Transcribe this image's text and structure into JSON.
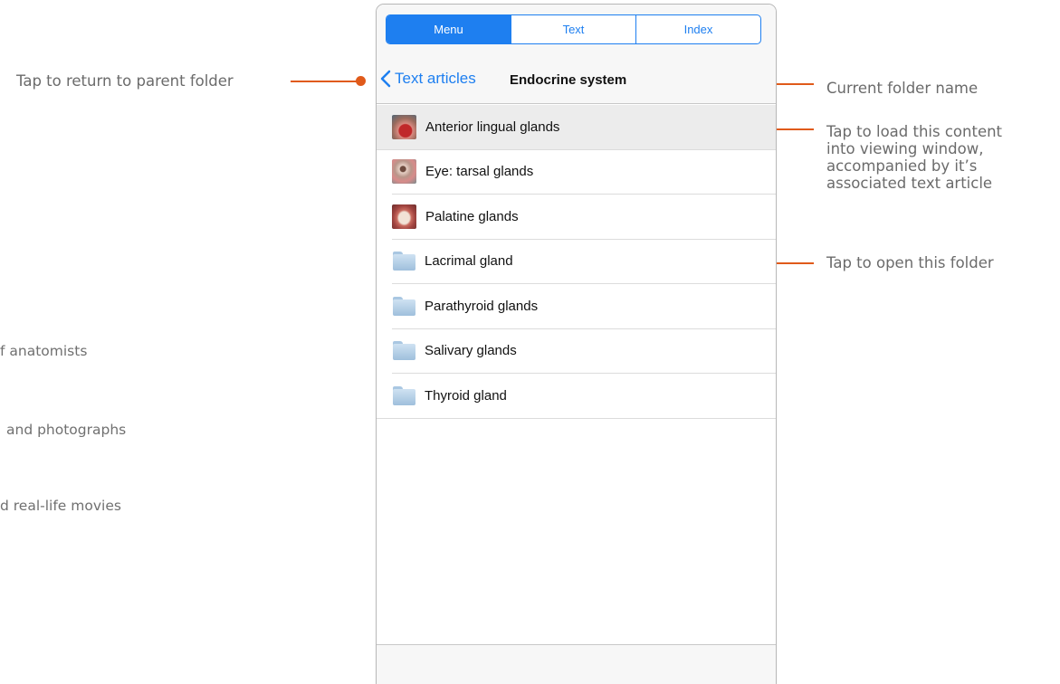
{
  "tabs": [
    {
      "label": "Menu",
      "active": true
    },
    {
      "label": "Text",
      "active": false
    },
    {
      "label": "Index",
      "active": false
    }
  ],
  "nav": {
    "back_label": "Text articles",
    "folder_title": "Endocrine system"
  },
  "items": [
    {
      "label": "Anterior lingual glands",
      "type": "article",
      "selected": true
    },
    {
      "label": "Eye: tarsal glands",
      "type": "article",
      "selected": false
    },
    {
      "label": "Palatine glands",
      "type": "article",
      "selected": false
    },
    {
      "label": "Lacrimal gland",
      "type": "folder",
      "selected": false
    },
    {
      "label": "Parathyroid glands",
      "type": "folder",
      "selected": false
    },
    {
      "label": "Salivary glands",
      "type": "folder",
      "selected": false
    },
    {
      "label": "Thyroid gland",
      "type": "folder",
      "selected": false
    }
  ],
  "callouts": {
    "parent_folder": "Tap to return to parent folder",
    "current_folder": "Current folder name",
    "load_content": [
      "Tap to load this content",
      "into viewing window,",
      "accompanied by it’s",
      "associated text article"
    ],
    "open_folder": "Tap to open this folder"
  },
  "background_text": [
    "f anatomists",
    "and photographs",
    "d real-life movies"
  ],
  "colors": {
    "accent": "#1e7ff0",
    "callout_line": "#e05a1a",
    "selected_row": "#ececec"
  }
}
